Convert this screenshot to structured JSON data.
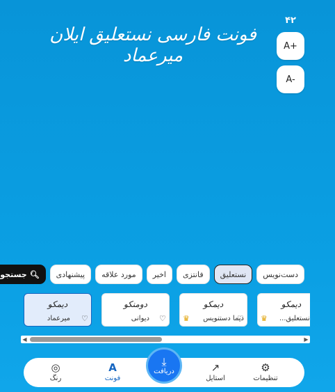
{
  "preview": {
    "size_value": "۴۲",
    "increase_label": "A+",
    "decrease_label": "A-",
    "headline": "فونت فارسی نستعلیق ایلان میرعماد"
  },
  "tabs": [
    {
      "label": "جستجو",
      "icon": "search-icon"
    },
    {
      "label": "پیشنهادی"
    },
    {
      "label": "مورد علاقه"
    },
    {
      "label": "اخیر"
    },
    {
      "label": "فانتزی"
    },
    {
      "label": "نستعلیق"
    },
    {
      "label": "دست‌نویس"
    }
  ],
  "fonts": [
    {
      "preview": "دیمکو",
      "name": "دیما نستعلیق...",
      "premium": true
    },
    {
      "preview": "دیمکو",
      "name": "دیما دستنویس",
      "premium": true
    },
    {
      "preview": "دومنکو",
      "name": "دیوانی",
      "premium": false
    },
    {
      "preview": "دیمکو",
      "name": "میرعماد",
      "premium": false
    }
  ],
  "nav": {
    "settings": "تنظیمات",
    "style": "استایل",
    "download": "دریافت",
    "font": "فونت",
    "color": "رنگ"
  },
  "colors": {
    "accent": "#1976f2",
    "background": "#0a9be0"
  }
}
